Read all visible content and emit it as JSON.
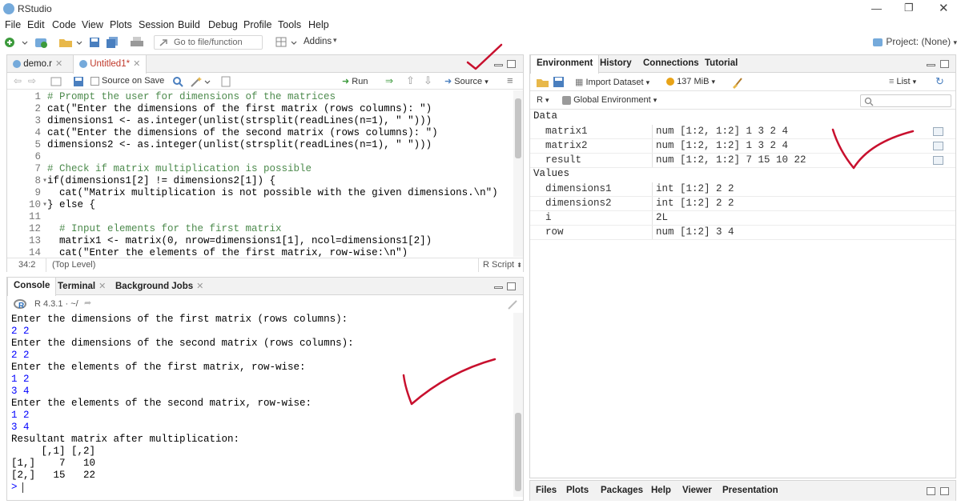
{
  "window": {
    "title": "RStudio"
  },
  "menu": [
    "File",
    "Edit",
    "Code",
    "View",
    "Plots",
    "Session",
    "Build",
    "Debug",
    "Profile",
    "Tools",
    "Help"
  ],
  "toolbar": {
    "goto_placeholder": "Go to file/function",
    "addins_label": "Addins",
    "project_label": "Project: (None)"
  },
  "editor": {
    "tabs": [
      {
        "label": "demo.r",
        "active": false
      },
      {
        "label": "Untitled1*",
        "active": true
      }
    ],
    "toolbar": {
      "source_on_save": "Source on Save",
      "run": "Run",
      "source": "Source"
    },
    "lines": [
      {
        "n": "1",
        "fold": "",
        "code": "# Prompt the user for dimensions of the matrices"
      },
      {
        "n": "2",
        "fold": "",
        "code": "cat(\"Enter the dimensions of the first matrix (rows columns): \")"
      },
      {
        "n": "3",
        "fold": "",
        "code": "dimensions1 <- as.integer(unlist(strsplit(readLines(n=1), \" \")))"
      },
      {
        "n": "4",
        "fold": "",
        "code": "cat(\"Enter the dimensions of the second matrix (rows columns): \")"
      },
      {
        "n": "5",
        "fold": "",
        "code": "dimensions2 <- as.integer(unlist(strsplit(readLines(n=1), \" \")))"
      },
      {
        "n": "6",
        "fold": "",
        "code": ""
      },
      {
        "n": "7",
        "fold": "",
        "code": "# Check if matrix multiplication is possible"
      },
      {
        "n": "8",
        "fold": "▾",
        "code": "if(dimensions1[2] != dimensions2[1]) {"
      },
      {
        "n": "9",
        "fold": "",
        "code": "  cat(\"Matrix multiplication is not possible with the given dimensions.\\n\")"
      },
      {
        "n": "10",
        "fold": "▾",
        "code": "} else {"
      },
      {
        "n": "11",
        "fold": "",
        "code": ""
      },
      {
        "n": "12",
        "fold": "",
        "code": "  # Input elements for the first matrix"
      },
      {
        "n": "13",
        "fold": "",
        "code": "  matrix1 <- matrix(0, nrow=dimensions1[1], ncol=dimensions1[2])"
      },
      {
        "n": "14",
        "fold": "",
        "code": "  cat(\"Enter the elements of the first matrix, row-wise:\\n\")"
      }
    ],
    "status": {
      "position": "34:2",
      "scope": "(Top Level)",
      "filetype": "R Script"
    }
  },
  "console": {
    "tabs": [
      {
        "label": "Console",
        "active": true
      },
      {
        "label": "Terminal",
        "active": false
      },
      {
        "label": "Background Jobs",
        "active": false
      }
    ],
    "version": "R 4.3.1 · ~/",
    "lines": [
      {
        "text": "Enter the dimensions of the first matrix (rows columns):",
        "input": false
      },
      {
        "text": "2 2",
        "input": true
      },
      {
        "text": "Enter the dimensions of the second matrix (rows columns):",
        "input": false
      },
      {
        "text": "2 2",
        "input": true
      },
      {
        "text": "Enter the elements of the first matrix, row-wise:",
        "input": false
      },
      {
        "text": "1 2",
        "input": true
      },
      {
        "text": "3 4",
        "input": true
      },
      {
        "text": "Enter the elements of the second matrix, row-wise:",
        "input": false
      },
      {
        "text": "1 2",
        "input": true
      },
      {
        "text": "3 4",
        "input": true
      },
      {
        "text": "Resultant matrix after multiplication:",
        "input": false
      },
      {
        "text": "     [,1] [,2]",
        "input": false
      },
      {
        "text": "[1,]    7   10",
        "input": false
      },
      {
        "text": "[2,]   15   22",
        "input": false
      }
    ],
    "prompt": ">"
  },
  "environment": {
    "tabs": [
      {
        "label": "Environment",
        "active": true
      },
      {
        "label": "History",
        "active": false
      },
      {
        "label": "Connections",
        "active": false
      },
      {
        "label": "Tutorial",
        "active": false
      }
    ],
    "import_label": "Import Dataset",
    "memory": "137 MiB",
    "view_mode": "List",
    "lang": "R",
    "scope": "Global Environment",
    "sections": [
      {
        "title": "Data",
        "rows": [
          {
            "name": "matrix1",
            "value": "num [1:2, 1:2] 1 3 2 4",
            "grid": true
          },
          {
            "name": "matrix2",
            "value": "num [1:2, 1:2] 1 3 2 4",
            "grid": true
          },
          {
            "name": "result",
            "value": "num [1:2, 1:2] 7 15 10 22",
            "grid": true
          }
        ]
      },
      {
        "title": "Values",
        "rows": [
          {
            "name": "dimensions1",
            "value": "int [1:2] 2 2",
            "grid": false
          },
          {
            "name": "dimensions2",
            "value": "int [1:2] 2 2",
            "grid": false
          },
          {
            "name": "i",
            "value": "2L",
            "grid": false
          },
          {
            "name": "row",
            "value": "num [1:2] 3 4",
            "grid": false
          }
        ]
      }
    ]
  },
  "files": {
    "tabs": [
      {
        "label": "Files"
      },
      {
        "label": "Plots"
      },
      {
        "label": "Packages"
      },
      {
        "label": "Help"
      },
      {
        "label": "Viewer"
      },
      {
        "label": "Presentation"
      }
    ]
  },
  "colors": {
    "checkmark": "#c8102e",
    "r_blue": "#75aadb",
    "input_text": "#0000ff"
  }
}
